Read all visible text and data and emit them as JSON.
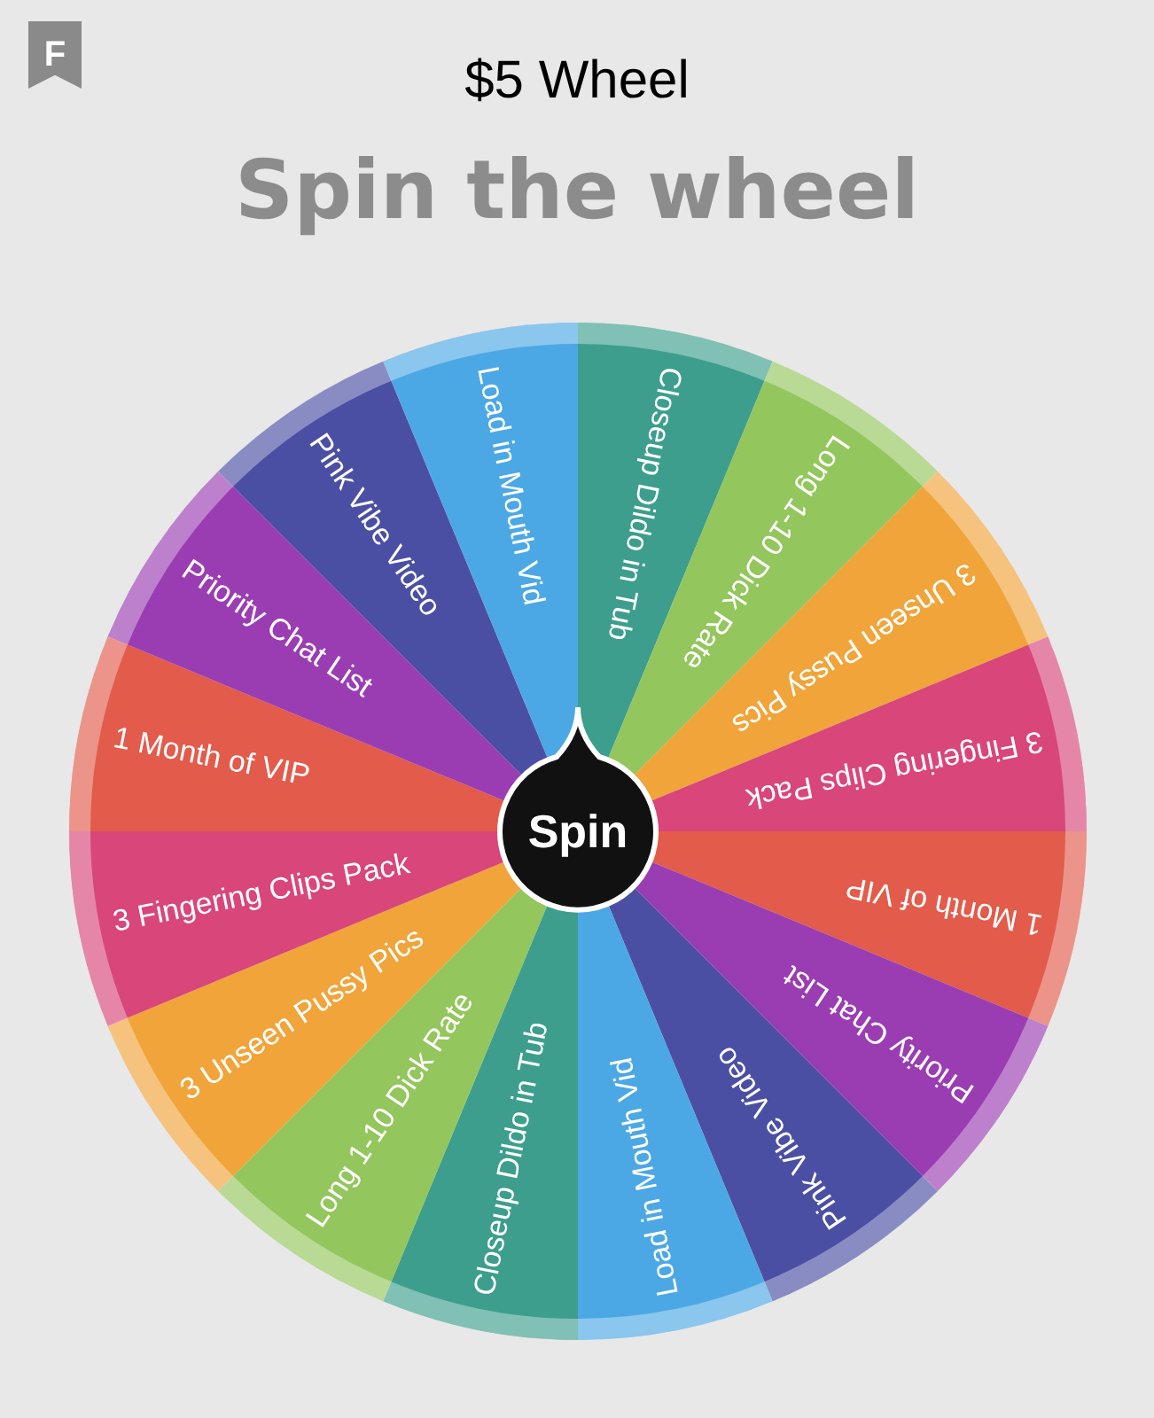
{
  "header": {
    "badge": "F",
    "title": "$5 Wheel"
  },
  "heading": "Spin the wheel",
  "spin_button": "Spin",
  "segments": [
    {
      "label": "Closeup Dildo in Tub",
      "color": "#3d9e8e"
    },
    {
      "label": "Long 1-10 Dick Rate",
      "color": "#93c65c"
    },
    {
      "label": "3 Unseen Pussy Pics",
      "color": "#f0a43a"
    },
    {
      "label": "3 Fingering Clips Pack",
      "color": "#d8467a"
    },
    {
      "label": "1 Month of VIP",
      "color": "#e25b4b"
    },
    {
      "label": "Priority Chat List",
      "color": "#9a3db2"
    },
    {
      "label": "Pink Vibe Video",
      "color": "#4b4fa3"
    },
    {
      "label": "Load in Mouth Vid",
      "color": "#4ca8e4"
    },
    {
      "label": "Closeup Dildo in Tub",
      "color": "#3d9e8e"
    },
    {
      "label": "Long 1-10 Dick Rate",
      "color": "#93c65c"
    },
    {
      "label": "3 Unseen Pussy Pics",
      "color": "#f0a43a"
    },
    {
      "label": "3 Fingering Clips Pack",
      "color": "#d8467a"
    },
    {
      "label": "1 Month of VIP",
      "color": "#e25b4b"
    },
    {
      "label": "Priority Chat List",
      "color": "#9a3db2"
    },
    {
      "label": "Pink Vibe Video",
      "color": "#4b4fa3"
    },
    {
      "label": "Load in Mouth Vid",
      "color": "#4ca8e4"
    }
  ]
}
